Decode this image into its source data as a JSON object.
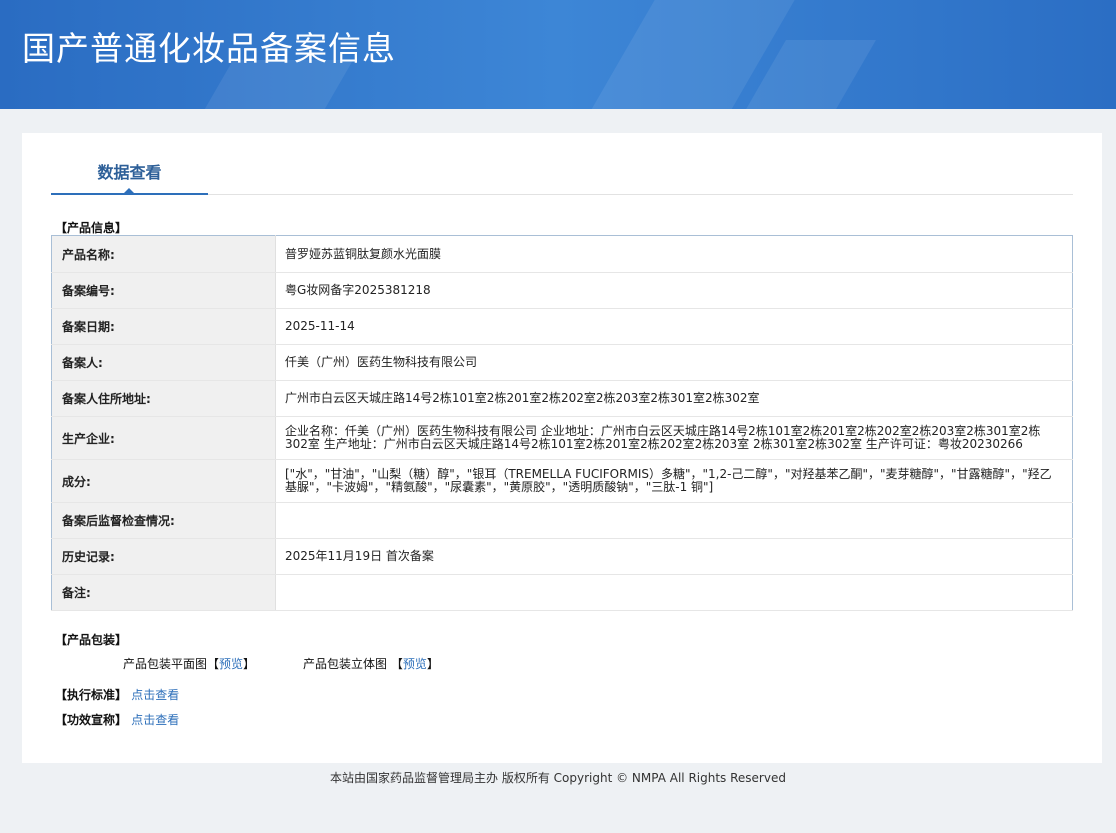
{
  "header": {
    "title": "国产普通化妆品备案信息"
  },
  "tabs": [
    {
      "label": "数据查看"
    }
  ],
  "product_info": {
    "section_title": "【产品信息】",
    "rows": [
      {
        "label": "产品名称:",
        "value": "普罗娅苏蓝铜肽复颜水光面膜"
      },
      {
        "label": "备案编号:",
        "value": "粤G妆网备字2025381218"
      },
      {
        "label": "备案日期:",
        "value": "2025-11-14"
      },
      {
        "label": "备案人:",
        "value": "仟美（广州）医药生物科技有限公司"
      },
      {
        "label": "备案人住所地址:",
        "value": "广州市白云区天城庄路14号2栋101室2栋201室2栋202室2栋203室2栋301室2栋302室"
      },
      {
        "label": "生产企业:",
        "value": "企业名称：仟美（广州）医药生物科技有限公司 企业地址：广州市白云区天城庄路14号2栋101室2栋201室2栋202室2栋203室2栋301室2栋302室 生产地址：广州市白云区天城庄路14号2栋101室2栋201室2栋202室2栋203室 2栋301室2栋302室 生产许可证：粤妆20230266"
      },
      {
        "label": "成分:",
        "value": "[\"水\"，\"甘油\"，\"山梨（糖）醇\"，\"银耳（TREMELLA FUCIFORMIS）多糖\"，\"1,2-己二醇\"，\"对羟基苯乙酮\"，\"麦芽糖醇\"，\"甘露糖醇\"，\"羟乙基脲\"，\"卡波姆\"，\"精氨酸\"，\"尿囊素\"，\"黄原胶\"，\"透明质酸钠\"，\"三肽-1 铜\"]"
      },
      {
        "label": "备案后监督检查情况:",
        "value": ""
      },
      {
        "label": "历史记录:",
        "value": "2025年11月19日 首次备案"
      },
      {
        "label": "备注:",
        "value": ""
      }
    ]
  },
  "packaging": {
    "section_title": "【产品包装】",
    "flat_label": "产品包装平面图",
    "flat_link": "预览",
    "solid_label": "产品包装立体图",
    "solid_link": "预览",
    "bracket_open": "【",
    "bracket_close": "】"
  },
  "standard": {
    "label": "【执行标准】",
    "link": "点击查看"
  },
  "efficacy": {
    "label": "【功效宣称】",
    "link": "点击查看"
  },
  "footer": {
    "text": "本站由国家药品监督管理局主办 版权所有 Copyright © NMPA All Rights Reserved"
  },
  "colors": {
    "header": "#2a6cc2",
    "link": "#2d6fba",
    "label_bg": "#f0f0f0"
  }
}
